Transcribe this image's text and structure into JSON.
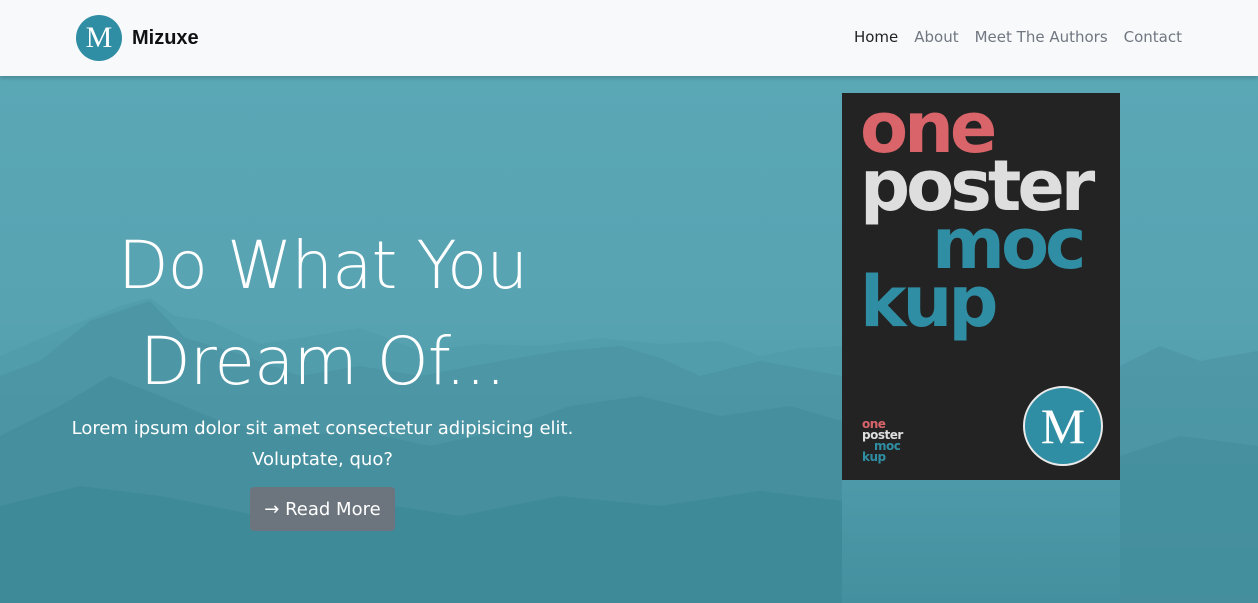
{
  "nav": {
    "brand_initial": "M",
    "brand_name": "Mizuxe",
    "links": [
      {
        "label": "Home",
        "active": true
      },
      {
        "label": "About",
        "active": false
      },
      {
        "label": "Meet The Authors",
        "active": false
      },
      {
        "label": "Contact",
        "active": false
      }
    ]
  },
  "hero": {
    "title_line1": "Do What You",
    "title_line2": "Dream Of...",
    "subtitle_line1": "Lorem ipsum dolor sit amet consectetur adipisicing elit.",
    "subtitle_line2": "Voluptate, quo?",
    "button_label": "→ Read More"
  },
  "poster": {
    "words": [
      "one",
      "poster",
      "moc",
      "kup"
    ],
    "logo_initial": "M"
  },
  "colors": {
    "brand": "#2f8ea3",
    "hero_bg": "#5aa6b5",
    "poster_bg": "#232323",
    "poster_red": "#d9646a",
    "button": "#6c757d"
  },
  "icons": {
    "brand_logo": "brand-logo-icon",
    "poster_logo": "poster-logo-icon"
  }
}
